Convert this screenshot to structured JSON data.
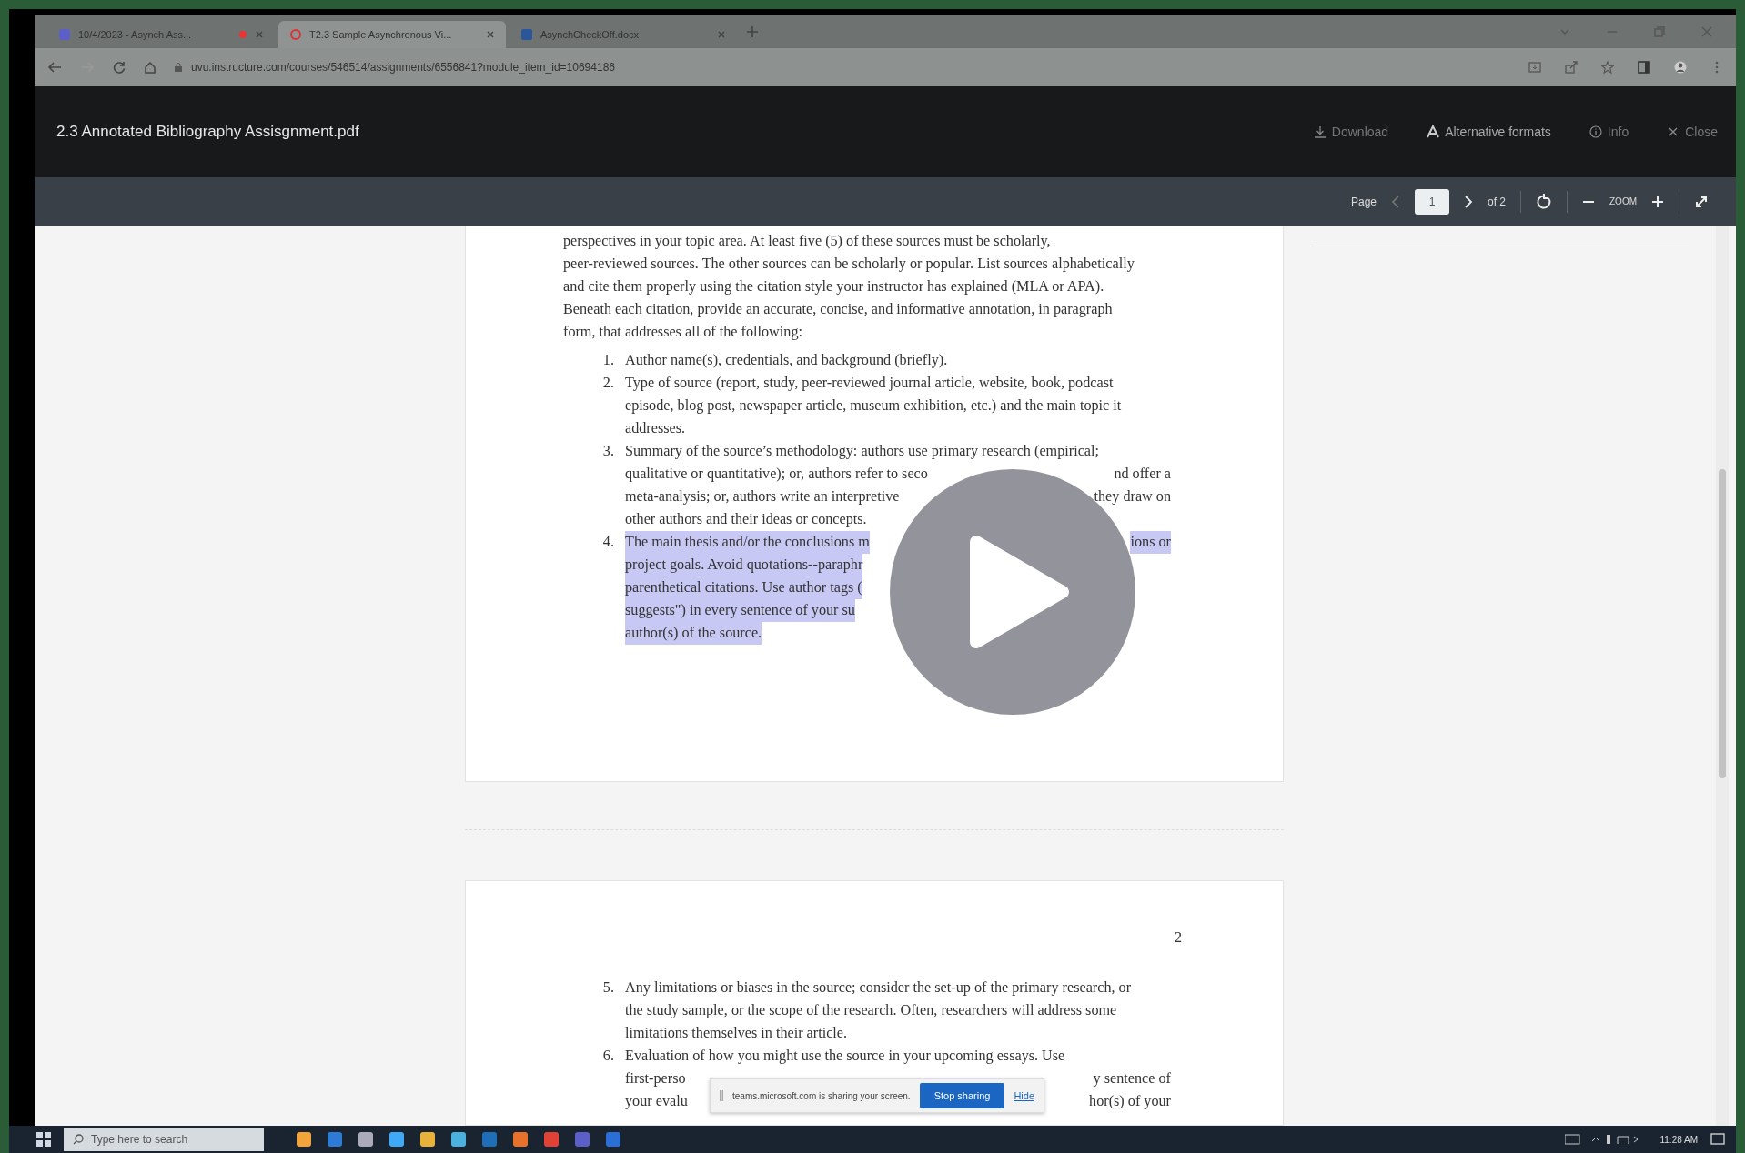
{
  "browser": {
    "tabs": [
      {
        "title": "10/4/2023 - Asynch Ass...",
        "recording": true,
        "selected": false
      },
      {
        "title": "T2.3 Sample Asynchronous Vi...",
        "recording": false,
        "selected": true
      },
      {
        "title": "AsynchCheckOff.docx",
        "recording": false,
        "selected": false
      }
    ],
    "url": "uvu.instructure.com/courses/546514/assignments/6556841?module_item_id=10694186"
  },
  "viewer": {
    "title": "2.3 Annotated Bibliography Assisgnment.pdf",
    "actions": [
      {
        "kind": "download",
        "label": "Download"
      },
      {
        "kind": "formats",
        "label": "Alternative formats"
      },
      {
        "kind": "info",
        "label": "Info"
      },
      {
        "kind": "close",
        "label": "Close"
      }
    ],
    "toolbar": {
      "page_label": "Page",
      "page_value": "1",
      "page_total": "of 2",
      "zoom_label": "ZOOM"
    }
  },
  "page_1": {
    "paragraph": [
      "perspectives in your topic area. At least five (5) of these sources must be scholarly,",
      "peer-reviewed sources. The other sources can be scholarly or popular. List sources alphabetically",
      "and cite them properly using the citation style your instructor has explained (MLA or APA).",
      "Beneath each citation, provide an accurate, concise, and informative annotation, in paragraph",
      "form, that addresses all of the following:"
    ],
    "items": [
      {
        "number": "1.",
        "highlighted": false,
        "lines": [
          {
            "left": "Author name(s), credentials, and background (briefly)."
          }
        ]
      },
      {
        "number": "2.",
        "highlighted": false,
        "lines": [
          {
            "left": "Type of source (report, study, peer-reviewed journal article, website, book, podcast"
          },
          {
            "left": "episode, blog post, newspaper article, museum exhibition, etc.) and the main topic it"
          },
          {
            "left": "addresses."
          }
        ]
      },
      {
        "number": "3.",
        "highlighted": false,
        "lines": [
          {
            "left": "Summary of the source’s methodology: authors use primary research (empirical;"
          },
          {
            "left": "qualitative or quantitative); or, authors refer to seco",
            "right": "nd offer a"
          },
          {
            "left": "meta-analysis; or, authors write an interpretive",
            "right": "they draw on"
          },
          {
            "left": "other authors and their ideas or concepts."
          }
        ]
      },
      {
        "number": "4.",
        "highlighted": true,
        "lines": [
          {
            "left": "The main thesis and/or the conclusions m",
            "right": "ions or"
          },
          {
            "left": "project goals. Avoid quotations--paraphr"
          },
          {
            "left": "parenthetical citations. Use author tags ("
          },
          {
            "left": "suggests\") in every sentence of your su"
          },
          {
            "left": "author(s) of the source."
          }
        ]
      }
    ]
  },
  "page_2": {
    "page_number": "2",
    "items": [
      {
        "number": "5.",
        "highlighted": false,
        "lines": [
          {
            "left": "Any limitations or biases in the source; consider the set-up of the primary research, or"
          },
          {
            "left": "the study sample, or the scope of the research. Often, researchers will address some"
          },
          {
            "left": "limitations themselves in their article."
          }
        ]
      },
      {
        "number": "6.",
        "highlighted": false,
        "lines": [
          {
            "left": "Evaluation of how you might use the source in your upcoming essays. Use"
          },
          {
            "left": "first-perso",
            "right": "y sentence of"
          },
          {
            "left": "your evalu",
            "right": "hor(s) of your"
          }
        ]
      }
    ]
  },
  "share_bar": {
    "message": "teams.microsoft.com is sharing your screen.",
    "stop_button": "Stop sharing",
    "hide_link": "Hide"
  },
  "taskbar": {
    "search_placeholder": "Type here to search",
    "time": "11:28 AM"
  }
}
